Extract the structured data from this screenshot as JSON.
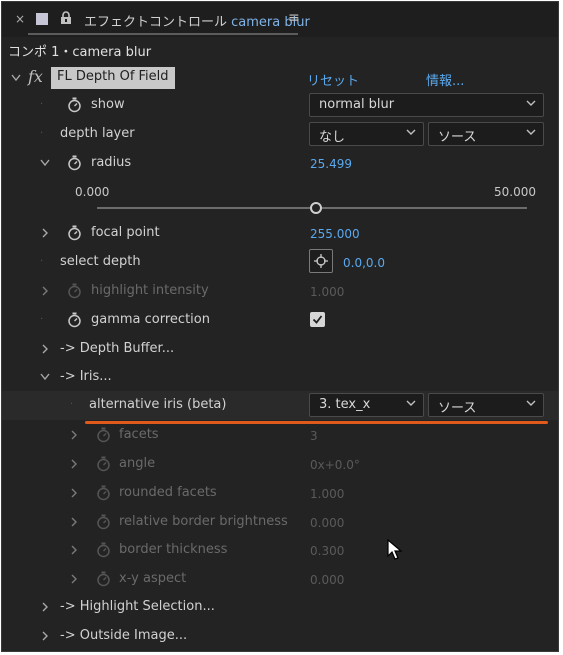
{
  "panel": {
    "close_glyph": "×",
    "title_prefix": "エフェクトコントロール",
    "title_layer": "camera blur",
    "menu_glyph": "≡",
    "comp_title": "コンポ 1・camera blur"
  },
  "effect": {
    "fx_symbol": "fx",
    "name": "FL Depth Of Field",
    "reset_label": "リセット",
    "info_label": "情報..."
  },
  "rows": {
    "show": {
      "label": "show",
      "dropdown": "normal blur"
    },
    "depth_layer": {
      "label": "depth layer",
      "layer_dropdown": "なし",
      "source_dropdown": "ソース"
    },
    "radius": {
      "label": "radius",
      "value": "25.499",
      "min": "0.000",
      "max": "50.000",
      "slider_fraction": 0.51
    },
    "focal_point": {
      "label": "focal point",
      "value": "255.000"
    },
    "select_depth": {
      "label": "select depth",
      "value": "0.0,0.0"
    },
    "highlight_intensity": {
      "label": "highlight intensity",
      "value": "1.000"
    },
    "gamma_correction": {
      "label": "gamma correction",
      "checked": true
    },
    "depth_buffer": {
      "label": "-> Depth Buffer..."
    },
    "iris": {
      "label": "-> Iris..."
    },
    "alternative_iris": {
      "label": "alternative iris (beta)",
      "layer_dropdown": "3. tex_x",
      "source_dropdown": "ソース"
    },
    "facets": {
      "label": "facets",
      "value": "3"
    },
    "angle": {
      "label": "angle",
      "value": "0x+0.0°"
    },
    "rounded_facets": {
      "label": "rounded facets",
      "value": "1.000"
    },
    "relative_border_brightness": {
      "label": "relative border brightness",
      "value": "0.000"
    },
    "border_thickness": {
      "label": "border thickness",
      "value": "0.300"
    },
    "xy_aspect": {
      "label": "x-y aspect",
      "value": "0.000"
    },
    "highlight_selection": {
      "label": "-> Highlight Selection..."
    },
    "outside_image": {
      "label": "-> Outside Image..."
    }
  },
  "colors": {
    "accent_blue": "#5aa8ee",
    "highlight_orange": "#e05a1c",
    "panel_bg": "#232323"
  }
}
